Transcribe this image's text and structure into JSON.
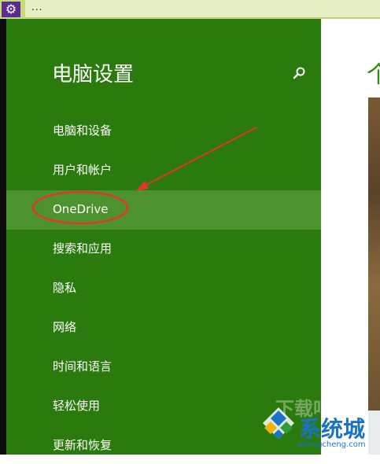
{
  "topbar": {
    "menu_dots": "..."
  },
  "sidebar": {
    "title": "电脑设置",
    "items": [
      {
        "label": "电脑和设备",
        "selected": false
      },
      {
        "label": "用户和帐户",
        "selected": false
      },
      {
        "label": "OneDrive",
        "selected": true
      },
      {
        "label": "搜索和应用",
        "selected": false
      },
      {
        "label": "隐私",
        "selected": false
      },
      {
        "label": "网络",
        "selected": false
      },
      {
        "label": "时间和语言",
        "selected": false
      },
      {
        "label": "轻松使用",
        "selected": false
      },
      {
        "label": "更新和恢复",
        "selected": false
      }
    ]
  },
  "right": {
    "heading_partial": "个"
  },
  "watermark": {
    "faint": "下载吧",
    "brand": "系统城",
    "url": "xitongcheng.com"
  },
  "colors": {
    "sidebar": "#2a7a0d",
    "selected": "#4c9330",
    "annotation": "#e0362b",
    "accent": "#5b2d91"
  },
  "icons": {
    "settings": "gear-icon",
    "search": "search-icon"
  }
}
